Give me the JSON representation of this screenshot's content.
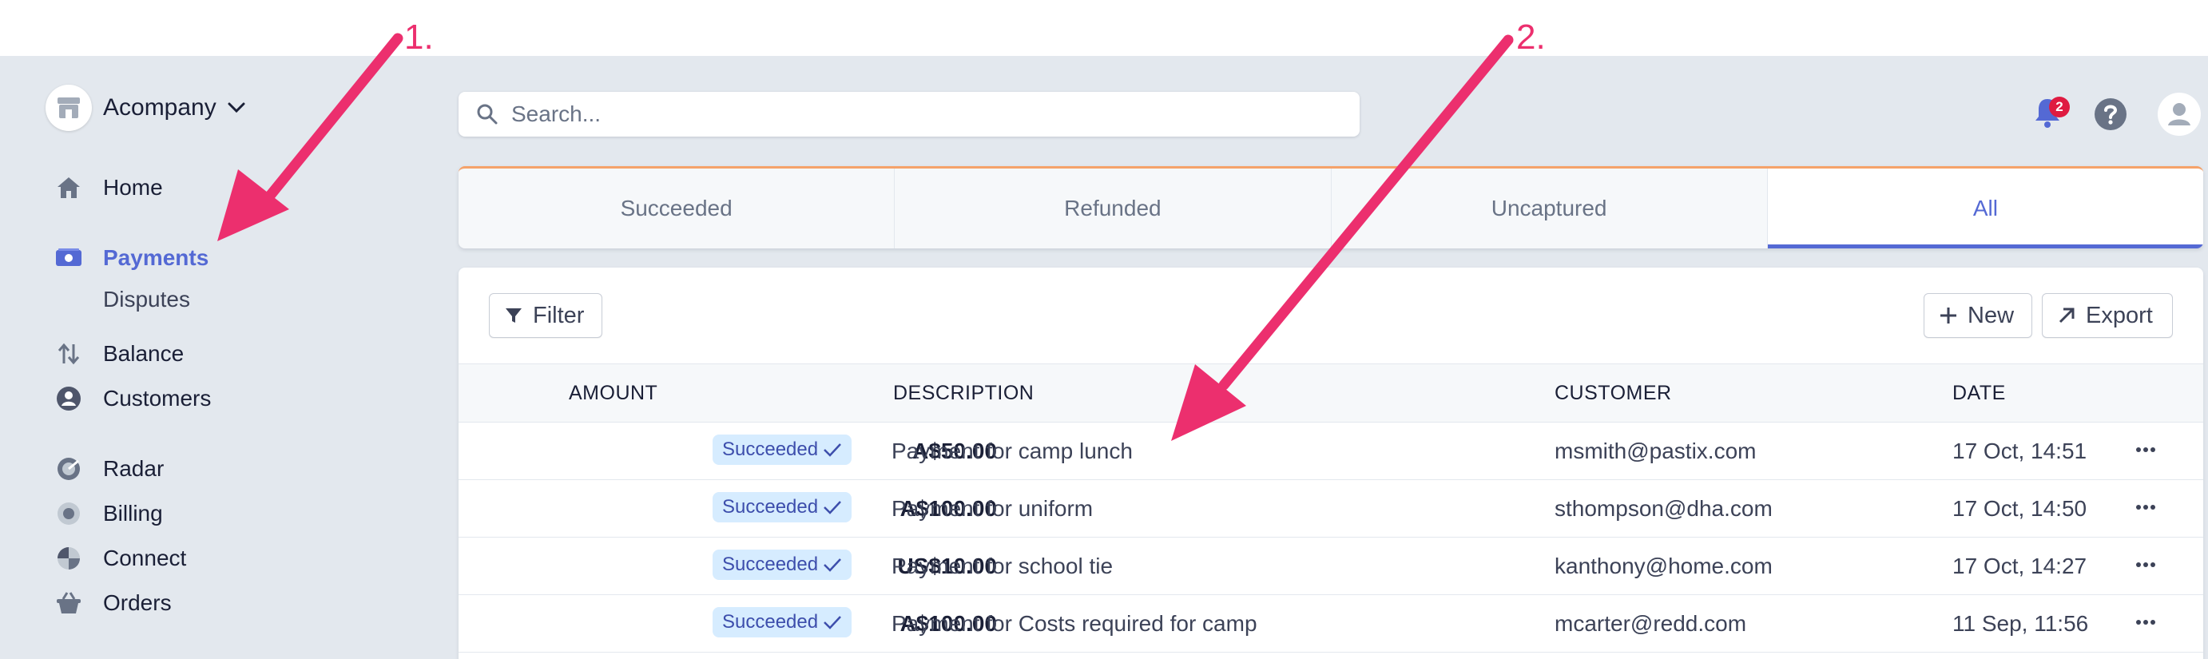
{
  "brand": {
    "name": "Acompany"
  },
  "sidebar": {
    "items": [
      {
        "label": "Home",
        "icon": "home-icon"
      },
      {
        "label": "Payments",
        "icon": "payments-icon",
        "active": true
      },
      {
        "label": "Disputes",
        "sub": true
      },
      {
        "label": "Balance",
        "icon": "balance-icon"
      },
      {
        "label": "Customers",
        "icon": "customers-icon"
      },
      {
        "label": "Radar",
        "icon": "radar-icon"
      },
      {
        "label": "Billing",
        "icon": "billing-icon"
      },
      {
        "label": "Connect",
        "icon": "connect-icon"
      },
      {
        "label": "Orders",
        "icon": "orders-icon"
      }
    ]
  },
  "header": {
    "search_placeholder": "Search...",
    "notification_count": "2"
  },
  "tabs": [
    {
      "label": "Succeeded"
    },
    {
      "label": "Refunded"
    },
    {
      "label": "Uncaptured"
    },
    {
      "label": "All",
      "active": true
    }
  ],
  "toolbar": {
    "filter_label": "Filter",
    "new_label": "New",
    "export_label": "Export"
  },
  "table": {
    "columns": {
      "amount": "AMOUNT",
      "description": "DESCRIPTION",
      "customer": "CUSTOMER",
      "date": "DATE"
    },
    "rows": [
      {
        "amount": "A$50.00",
        "status": "Succeeded",
        "description": "Payment for camp lunch",
        "customer": "msmith@pastix.com",
        "date": "17 Oct, 14:51"
      },
      {
        "amount": "A$100.00",
        "status": "Succeeded",
        "description": "Payment for uniform",
        "customer": "sthompson@dha.com",
        "date": "17 Oct, 14:50"
      },
      {
        "amount": "US$10.00",
        "status": "Succeeded",
        "description": "Payment for school tie",
        "customer": "kanthony@home.com",
        "date": "17 Oct, 14:27"
      },
      {
        "amount": "A$100.00",
        "status": "Succeeded",
        "description": "Payment for Costs required for camp",
        "customer": "mcarter@redd.com",
        "date": "11 Sep, 11:56"
      }
    ]
  },
  "annotations": {
    "label_1": "1.",
    "label_2": "2.",
    "color": "#ec2f6e"
  },
  "colors": {
    "accent": "#5469d4",
    "background": "#e3e8ee",
    "badge": "#df1b41",
    "status_bg": "#d6ecff"
  }
}
